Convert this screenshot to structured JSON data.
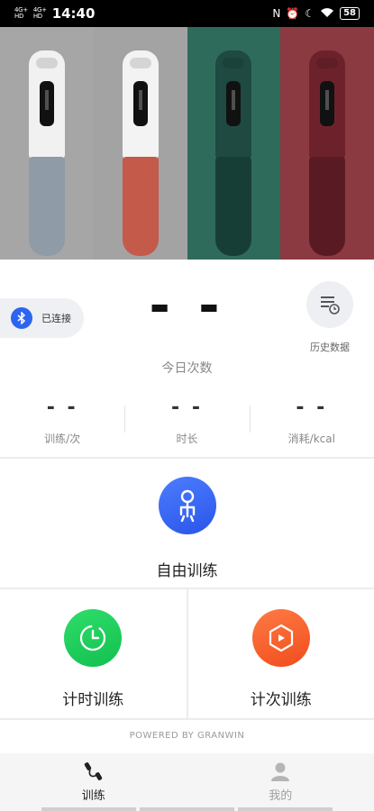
{
  "status_bar": {
    "network_1": "4G+\nHD",
    "network_2": "4G+\nHD",
    "time": "14:40",
    "icons": [
      "nfc-icon",
      "alarm-icon",
      "moon-icon",
      "wifi-icon"
    ],
    "battery": "58"
  },
  "banner": {
    "panels": [
      {
        "bg": "#a6a6a6",
        "cap": "#f1f1f1",
        "grip": "#8f9ba6"
      },
      {
        "bg": "#a3a3a3",
        "cap": "#f3f3f3",
        "grip": "#c45a49"
      },
      {
        "bg": "#2f6b5a",
        "cap": "#1e4a42",
        "grip": "#173e36"
      },
      {
        "bg": "#8c3a42",
        "cap": "#6d222b",
        "grip": "#5a1a23"
      }
    ]
  },
  "device": {
    "status_label": "已连接",
    "bluetooth_icon": "bluetooth-icon"
  },
  "today": {
    "count": "- -",
    "label": "今日次数"
  },
  "history": {
    "label": "历史数据",
    "icon": "history-list-icon"
  },
  "stats": [
    {
      "value": "- -",
      "label": "训练/次"
    },
    {
      "value": "- -",
      "label": "时长"
    },
    {
      "value": "- -",
      "label": "消耗/kcal"
    }
  ],
  "modes": {
    "free": {
      "label": "自由训练",
      "icon": "person-jump-icon",
      "color": "#2f5ef0"
    },
    "timer": {
      "label": "计时训练",
      "icon": "clock-icon",
      "color": "#1cc85a"
    },
    "count": {
      "label": "计次训练",
      "icon": "hexagon-counter-icon",
      "color": "#f45a25"
    }
  },
  "footer": {
    "powered": "POWERED BY GRANWIN"
  },
  "tabs": [
    {
      "label": "训练",
      "icon": "jump-rope-icon",
      "active": true
    },
    {
      "label": "我的",
      "icon": "user-icon",
      "active": false
    }
  ]
}
